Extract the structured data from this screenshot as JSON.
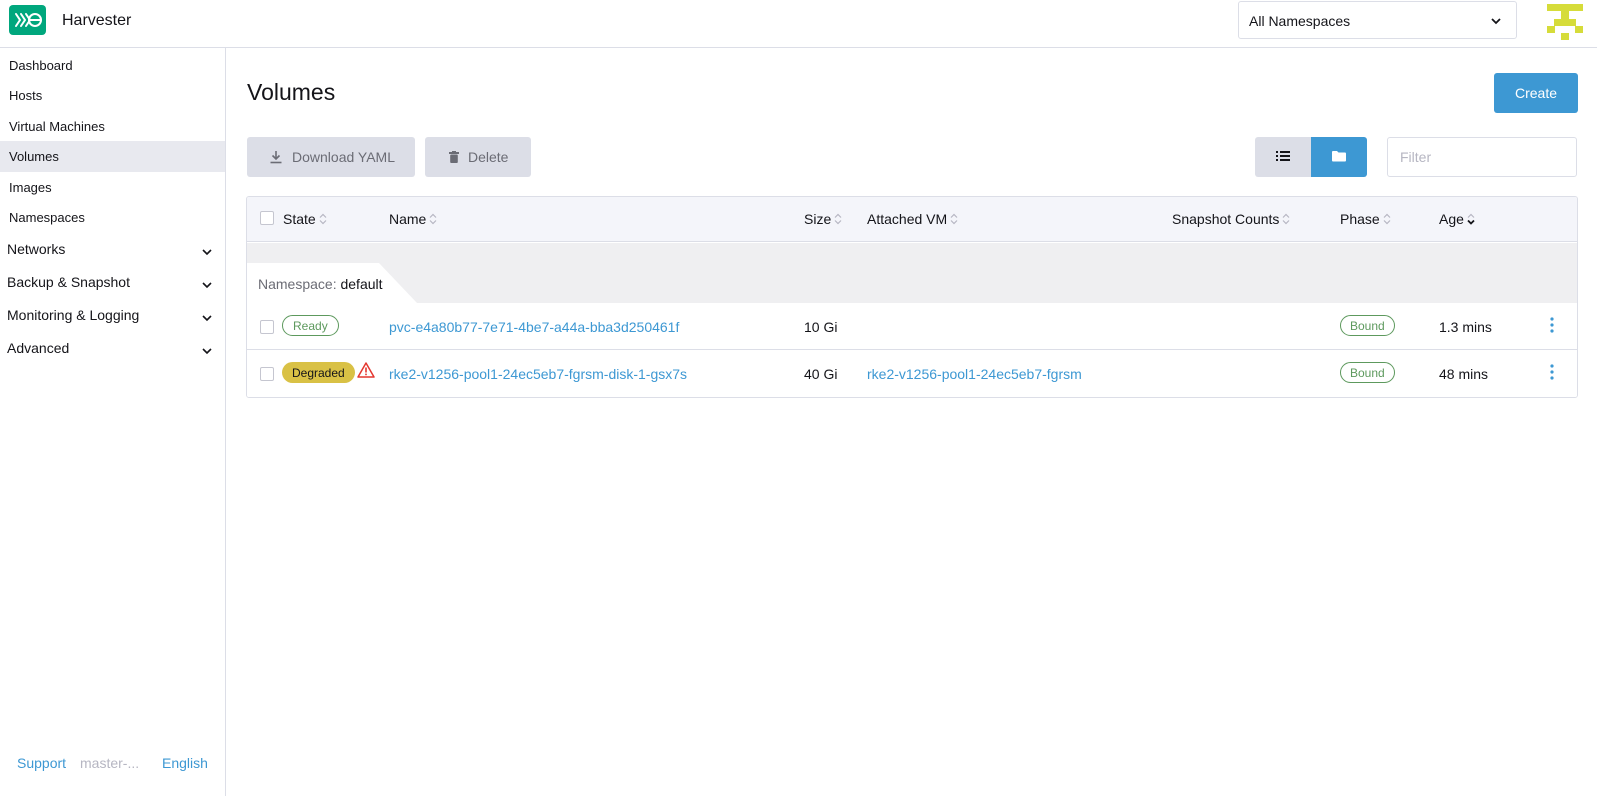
{
  "header": {
    "app_title": "Harvester",
    "namespace_select": "All Namespaces",
    "logo_icon": "harvester-logo",
    "accent_color": "#00a77d"
  },
  "sidebar": {
    "items": [
      {
        "label": "Dashboard"
      },
      {
        "label": "Hosts"
      },
      {
        "label": "Virtual Machines"
      },
      {
        "label": "Volumes",
        "active": true
      },
      {
        "label": "Images"
      },
      {
        "label": "Namespaces"
      }
    ],
    "groups": [
      {
        "label": "Networks"
      },
      {
        "label": "Backup & Snapshot"
      },
      {
        "label": "Monitoring & Logging"
      },
      {
        "label": "Advanced"
      }
    ],
    "footer": {
      "support": "Support",
      "version": "master-...",
      "language": "English"
    }
  },
  "main": {
    "title": "Volumes",
    "create_label": "Create",
    "download_label": "Download YAML",
    "delete_label": "Delete",
    "filter_placeholder": "Filter",
    "primary_color": "#3d98d3"
  },
  "table": {
    "columns": [
      "State",
      "Name",
      "Size",
      "Attached VM",
      "Snapshot Counts",
      "Phase",
      "Age"
    ],
    "group": {
      "prefix": "Namespace:",
      "value": "default"
    },
    "rows": [
      {
        "state": "Ready",
        "name": "pvc-e4a80b77-7e71-4be7-a44a-bba3d250461f",
        "size": "10 Gi",
        "attached_vm": "",
        "snapshot_counts": "",
        "phase": "Bound",
        "age": "1.3 mins"
      },
      {
        "state": "Degraded",
        "name": "rke2-v1256-pool1-24ec5eb7-fgrsm-disk-1-gsx7s",
        "size": "40 Gi",
        "attached_vm": "rke2-v1256-pool1-24ec5eb7-fgrsm",
        "snapshot_counts": "",
        "phase": "Bound",
        "age": "48 mins"
      }
    ]
  }
}
